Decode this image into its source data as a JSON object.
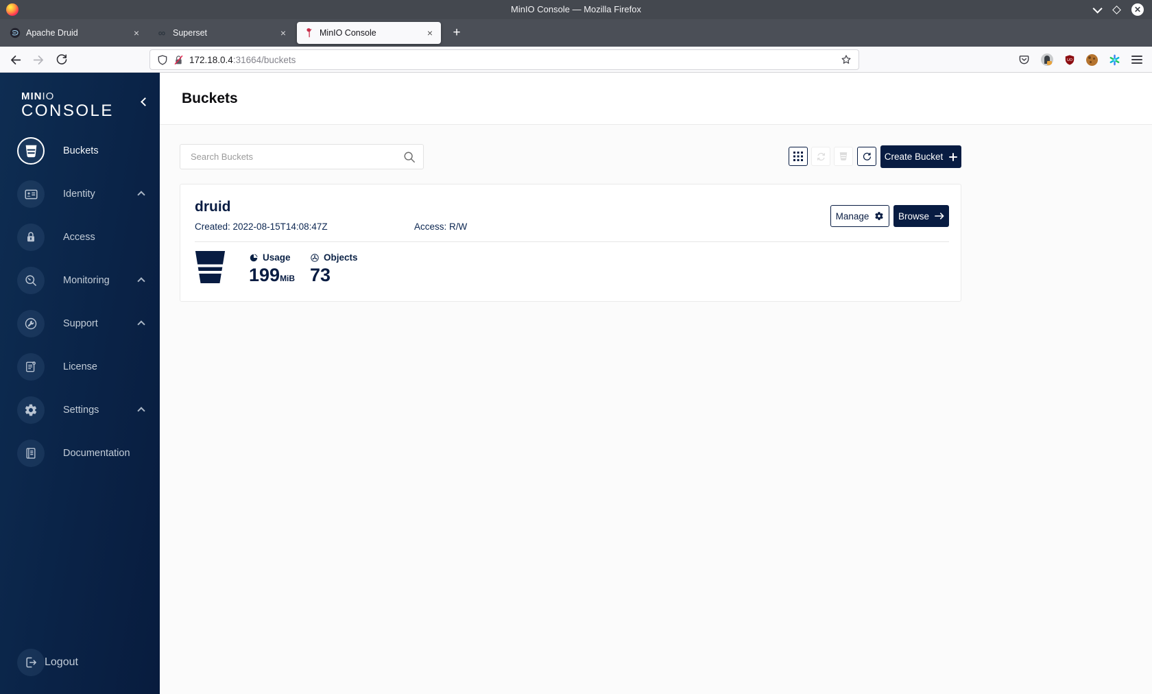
{
  "titlebar": {
    "title": "MinIO Console — Mozilla Firefox"
  },
  "tabs": [
    {
      "label": "Apache Druid"
    },
    {
      "label": "Superset"
    },
    {
      "label": "MinIO Console"
    }
  ],
  "navbar": {
    "url_host": "172.18.0.4",
    "url_path": ":31664/buckets"
  },
  "icons": {
    "tab_close": "×",
    "new_tab": "+",
    "superset_infinity": "∞",
    "ublock_text": "UO",
    "window_close": "✕"
  },
  "sidebar": {
    "logo_min": "MIN",
    "logo_io": "IO",
    "logo_console": "CONSOLE",
    "items": [
      {
        "label": "Buckets"
      },
      {
        "label": "Identity"
      },
      {
        "label": "Access"
      },
      {
        "label": "Monitoring"
      },
      {
        "label": "Support"
      },
      {
        "label": "License"
      },
      {
        "label": "Settings"
      },
      {
        "label": "Documentation"
      }
    ],
    "logout_label": "Logout"
  },
  "page": {
    "title": "Buckets",
    "search_placeholder": "Search Buckets",
    "create_bucket_label": "Create Bucket"
  },
  "bucket_card": {
    "name": "druid",
    "created": "Created: 2022-08-15T14:08:47Z",
    "access": "Access: R/W",
    "manage_label": "Manage",
    "browse_label": "Browse",
    "usage_label": "Usage",
    "usage_value": "199",
    "usage_unit": "MiB",
    "objects_label": "Objects",
    "objects_value": "73"
  },
  "colors": {
    "navy": "#081C42",
    "minio_red": "#C72E49",
    "sidebar_gradient_start": "#0e2d52",
    "sidebar_gradient_end": "#081c3e",
    "content_bg": "#fbfbfb"
  }
}
